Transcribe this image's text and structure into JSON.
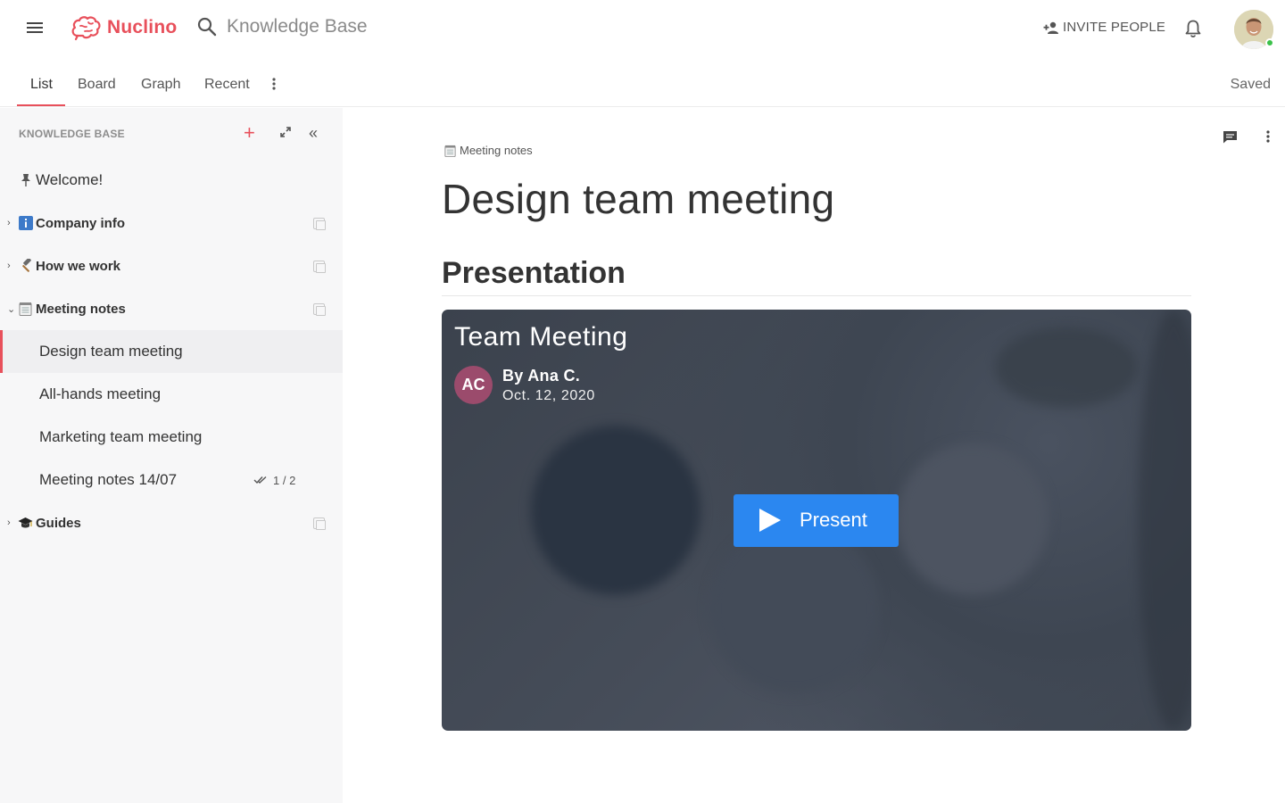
{
  "header": {
    "app_name": "Nuclino",
    "search_placeholder": "Knowledge Base",
    "invite_label": "INVITE PEOPLE"
  },
  "tabs": {
    "items": [
      "List",
      "Board",
      "Graph",
      "Recent"
    ],
    "active": "List",
    "status": "Saved"
  },
  "sidebar": {
    "header": "KNOWLEDGE BASE",
    "items": [
      {
        "label": "Welcome!",
        "icon": "pin-icon"
      },
      {
        "label": "Company info",
        "icon": "info-icon"
      },
      {
        "label": "How we work",
        "icon": "hammer-icon"
      },
      {
        "label": "Meeting notes",
        "icon": "notepad-icon"
      },
      {
        "label": "Design team meeting"
      },
      {
        "label": "All-hands meeting"
      },
      {
        "label": "Marketing team meeting"
      },
      {
        "label": "Meeting notes 14/07",
        "tasks": "1 / 2"
      },
      {
        "label": "Guides",
        "icon": "graduation-cap-icon"
      }
    ]
  },
  "main": {
    "breadcrumb": "Meeting notes",
    "title": "Design team meeting",
    "section": "Presentation",
    "embed": {
      "title": "Team Meeting",
      "initials": "AC",
      "author": "By Ana C.",
      "date": "Oct. 12, 2020",
      "button": "Present"
    }
  },
  "colors": {
    "accent": "#e8505b",
    "present_button": "#2b87f0",
    "online_dot": "#3bc14a",
    "avatar_initials_bg": "#9b4b6c"
  }
}
